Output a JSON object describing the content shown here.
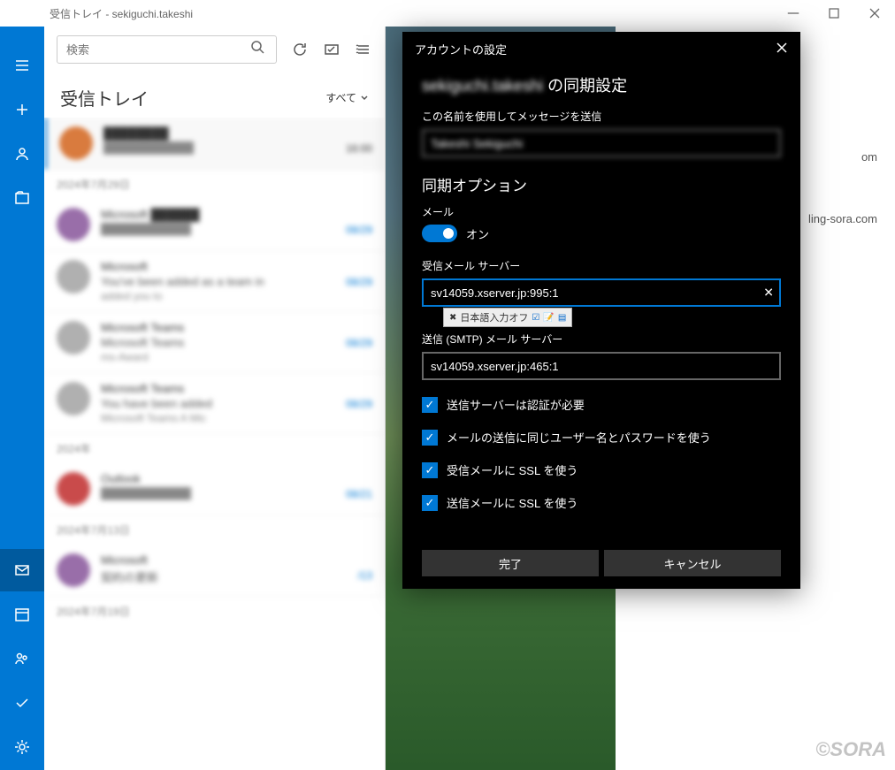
{
  "window": {
    "title": "受信トレイ - sekiguchi.takeshi"
  },
  "toolbar": {
    "search_placeholder": "検索"
  },
  "folder": {
    "title": "受信トレイ",
    "filter": "すべて"
  },
  "mails": {
    "item0_date": "16:00",
    "date_header1": "2024年7月29日",
    "item1_date": "08/29",
    "item2_sender": "Microsoft",
    "item2_subject": "You've been added as a team in",
    "item2_preview": "added you to",
    "item2_date": "08/29",
    "item3_sender": "Microsoft Teams",
    "item3_subject": "Microsoft Teams",
    "item3_preview": "ms-Award",
    "item3_date": "08/29",
    "item4_sender": "Microsoft Teams",
    "item4_subject": "You have been added",
    "item4_preview": "Microsoft Teams A Mic",
    "item4_date": "08/29",
    "date_header2": "2024年",
    "item5_sender": "Outlook",
    "item5_date": "08/21",
    "date_header3": "2024年7月13日",
    "item6_sender": "Microsoft",
    "item6_subject": "契約の更新",
    "item6_date": "/13",
    "date_header4": "2024年7月19日"
  },
  "preview": {
    "text1": "om",
    "text2": "ling-sora.com"
  },
  "dialog": {
    "header": "アカウントの設定",
    "title_account": "sekiguchi.takeshi",
    "title_suffix": " の同期設定",
    "name_label": "この名前を使用してメッセージを送信",
    "name_value": "Takeshi Sekiguchi",
    "section_sync": "同期オプション",
    "mail_label": "メール",
    "toggle_state": "オン",
    "incoming_label": "受信メール サーバー",
    "incoming_value": "sv14059.xserver.jp:995:1",
    "ime_text": "日本語入力オフ",
    "outgoing_label": "送信 (SMTP) メール サーバー",
    "outgoing_value": "sv14059.xserver.jp:465:1",
    "check1": "送信サーバーは認証が必要",
    "check2": "メールの送信に同じユーザー名とパスワードを使う",
    "check3": "受信メールに SSL を使う",
    "check4": "送信メールに SSL を使う",
    "btn_done": "完了",
    "btn_cancel": "キャンセル"
  },
  "watermark": "©SORA"
}
